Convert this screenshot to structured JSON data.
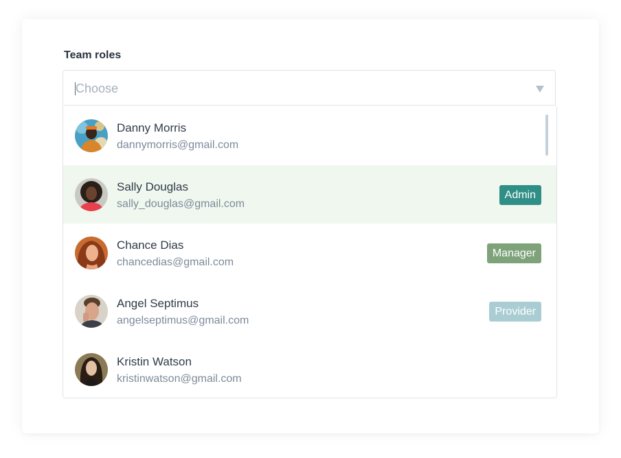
{
  "field": {
    "label": "Team roles",
    "placeholder": "Choose"
  },
  "options": [
    {
      "name": "Danny Morris",
      "email": "dannymorris@gmail.com",
      "badge": "",
      "selected": false,
      "avatar_bg": "#4aa0c4"
    },
    {
      "name": "Sally Douglas",
      "email": "sally_douglas@gmail.com",
      "badge": "Admin",
      "badge_color": "#2f8f86",
      "selected": true,
      "avatar_bg": "#c9c9c4"
    },
    {
      "name": "Chance Dias",
      "email": "chancedias@gmail.com",
      "badge": "Manager",
      "badge_color": "#7ea37a",
      "selected": false,
      "avatar_bg": "#c86b2e"
    },
    {
      "name": "Angel Septimus",
      "email": "angelseptimus@gmail.com",
      "badge": "Provider",
      "badge_color": "#a9cdd3",
      "selected": false,
      "avatar_bg": "#b7a08a"
    },
    {
      "name": "Kristin Watson",
      "email": "kristinwatson@gmail.com",
      "badge": "",
      "selected": false,
      "avatar_bg": "#6d5a3a"
    }
  ],
  "colors": {
    "selected_row_bg": "#f0f7ef",
    "border": "#dfe3e8"
  }
}
